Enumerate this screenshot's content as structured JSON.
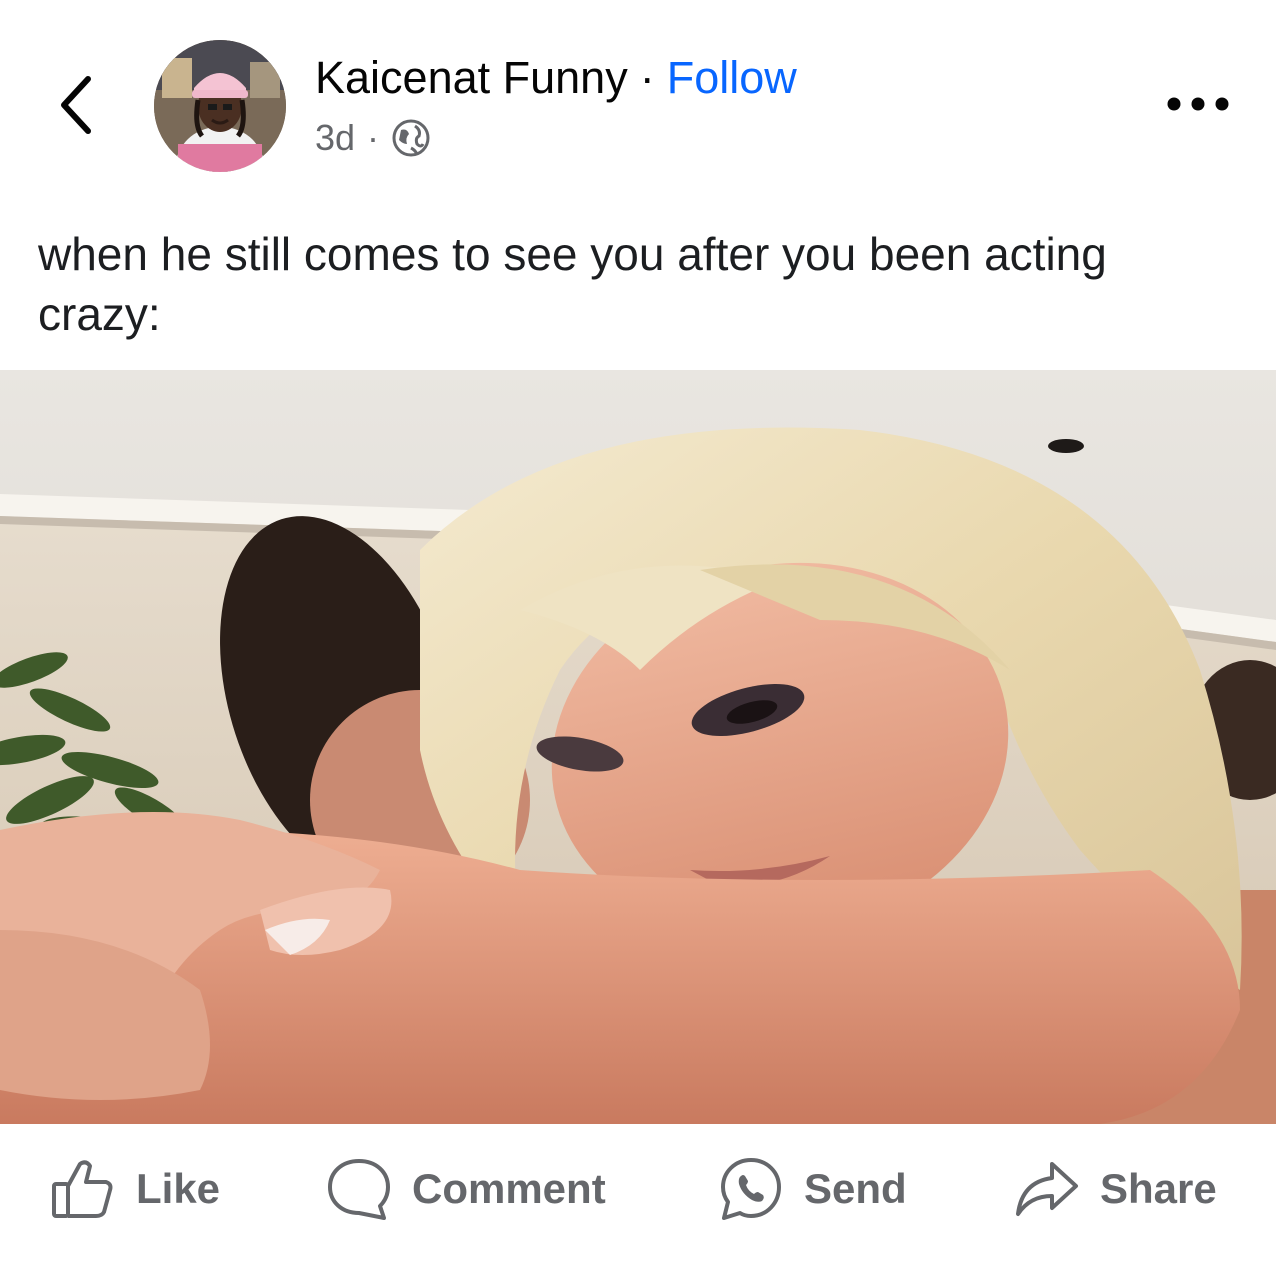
{
  "header": {
    "author_name": "Kaicenat Funny",
    "separator": "·",
    "follow_label": "Follow",
    "timestamp": "3d",
    "meta_separator": "·",
    "back_icon": "chevron-left-icon",
    "privacy_icon": "globe-icon",
    "more_icon": "more-horizontal-icon"
  },
  "post": {
    "caption": "when he still comes to see you after you been acting crazy:"
  },
  "actions": {
    "like_label": "Like",
    "comment_label": "Comment",
    "send_label": "Send",
    "share_label": "Share"
  },
  "colors": {
    "accent": "#0866ff",
    "secondary_text": "#65676b",
    "primary_text": "#050505"
  }
}
